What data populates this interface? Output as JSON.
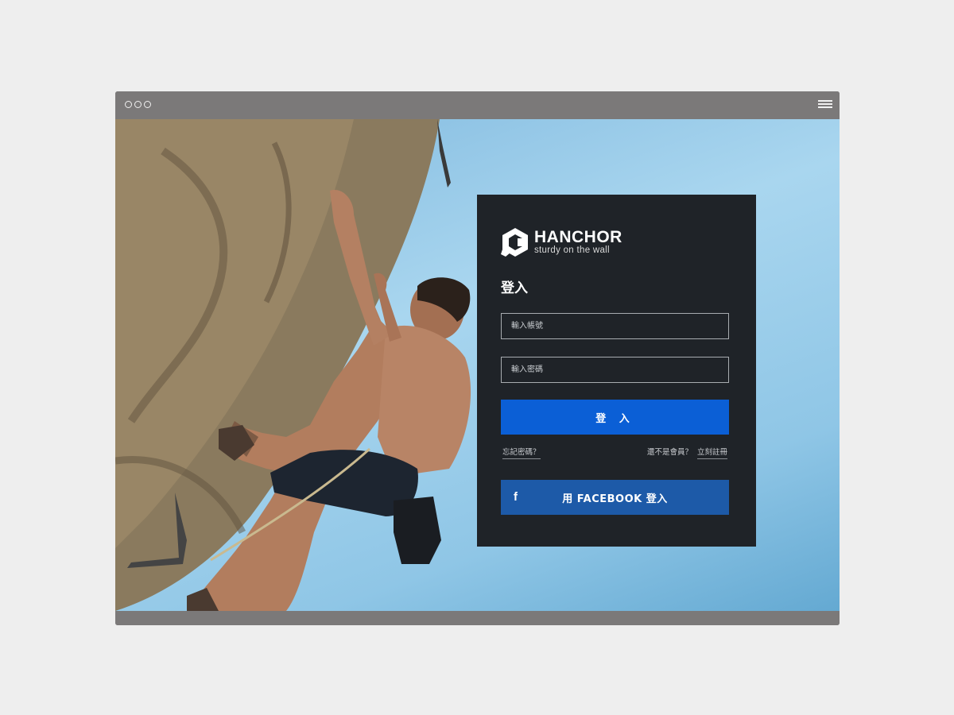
{
  "window": {
    "menu_icon": "hamburger-menu-icon"
  },
  "brand": {
    "name": "HANCHOR",
    "tagline": "sturdy on the wall"
  },
  "login": {
    "title": "登入",
    "username_placeholder": "輸入帳號",
    "password_placeholder": "輸入密碼",
    "submit_label": "登 入",
    "forgot_label": "忘記密碼？",
    "not_member_label": "還不是會員？",
    "register_label": "立刻註冊",
    "facebook_icon": "f",
    "facebook_label": "用 FACEBOOK 登入"
  },
  "colors": {
    "panel": "#1f2328",
    "primary_button": "#0b5fd6",
    "facebook_button": "#1d5aa8",
    "window_chrome": "#7b7979"
  }
}
